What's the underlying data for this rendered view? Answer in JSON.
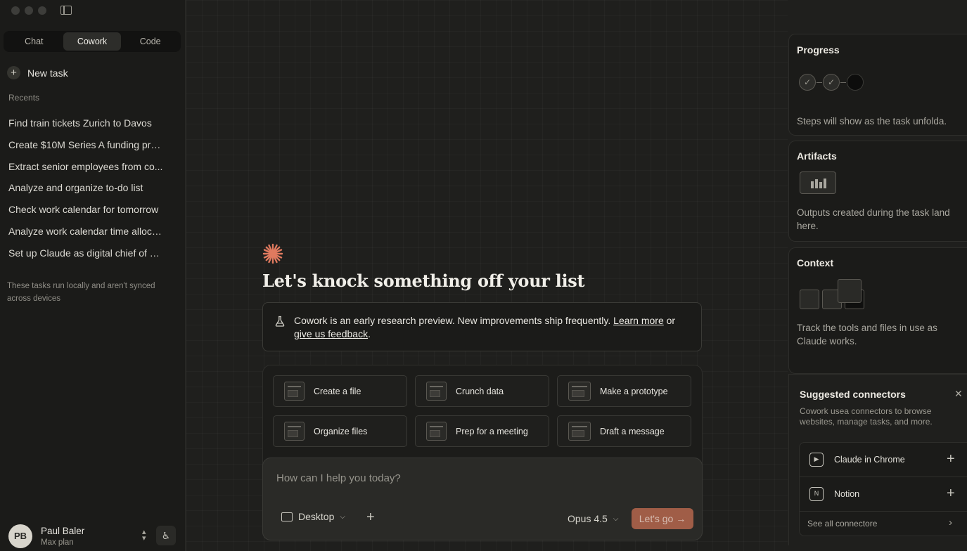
{
  "sidebar": {
    "mode_tabs": [
      "Chat",
      "Cowork",
      "Code"
    ],
    "active_tab": "Cowork",
    "new_task_label": "New task",
    "recents_label": "Recents",
    "recents": [
      "Find train tickets Zurich to Davos",
      "Create $10M Series A funding pre...",
      "Extract senior employees from co...",
      "Analyze and organize to-do list",
      "Check work calendar for tomorrow",
      "Analyze work calendar time alloca...",
      "Set up Claude as digital chief of st..."
    ],
    "local_note": "These tasks run locally and aren't synced across devices",
    "user": {
      "initials": "PB",
      "name": "Paul Baler",
      "plan": "Max plan"
    }
  },
  "main": {
    "headline": "Let's knock something off your list",
    "notice": {
      "text": "Cowork is an early research preview. New improvements ship frequently.",
      "learn_more": "Learn more",
      "or": "or",
      "feedback": "give us feedback",
      "period": "."
    },
    "tiles": [
      "Create a file",
      "Crunch data",
      "Make a prototype",
      "Organize files",
      "Prep for a meeting",
      "Draft a message"
    ],
    "composer": {
      "placeholder": "How can I help you today?",
      "folder_label": "Desktop",
      "model_label": "Opus 4.5",
      "go_label": "Let's go"
    }
  },
  "right_panel": {
    "progress": {
      "title": "Progress",
      "desc": "Steps will show as the task unfolda."
    },
    "artifacts": {
      "title": "Artifacts",
      "desc": "Outputs created during the task land here."
    },
    "context": {
      "title": "Context",
      "desc": "Track the tools and files in use as Claude works."
    },
    "connectors": {
      "title": "Suggested connectors",
      "desc": "Cowork usea connectors to browse websites, manage tasks, and more.",
      "items": [
        "Claude in Chrome",
        "Notion"
      ],
      "see_all": "See all connectore"
    }
  },
  "colors": {
    "accent": "#b5664d",
    "spark": "#e07a5f"
  }
}
